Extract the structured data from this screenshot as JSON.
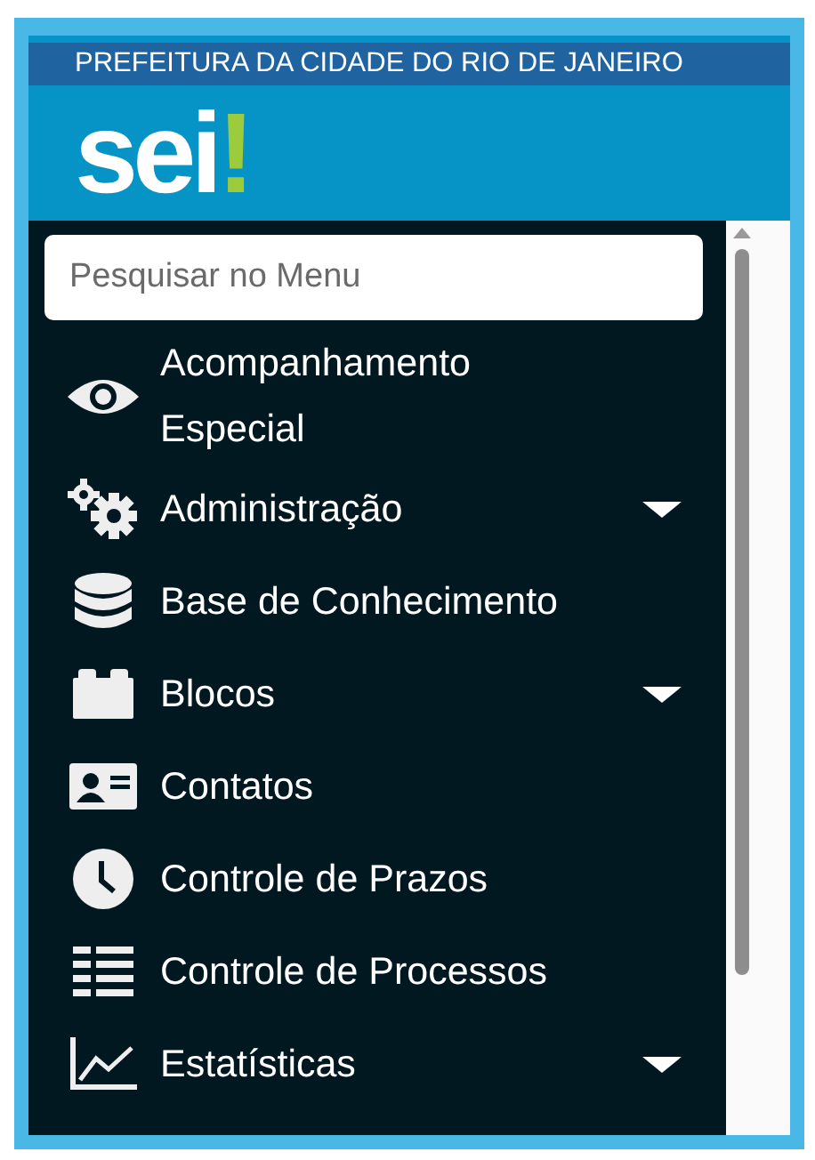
{
  "banner": {
    "title": "PREFEITURA DA CIDADE DO RIO DE JANEIRO"
  },
  "logo": {
    "text": "sei",
    "mark": "!"
  },
  "search": {
    "placeholder": "Pesquisar no Menu"
  },
  "menu": [
    {
      "label": "Acompanhamento Especial",
      "kind": "eye",
      "submenu": false
    },
    {
      "label": "Administração",
      "kind": "gears",
      "submenu": true
    },
    {
      "label": "Base de Conhecimento",
      "kind": "database",
      "submenu": false
    },
    {
      "label": "Blocos",
      "kind": "blocks",
      "submenu": true
    },
    {
      "label": "Contatos",
      "kind": "contact",
      "submenu": false
    },
    {
      "label": "Controle de Prazos",
      "kind": "clock",
      "submenu": false
    },
    {
      "label": "Controle de Processos",
      "kind": "list",
      "submenu": false
    },
    {
      "label": "Estatísticas",
      "kind": "chart",
      "submenu": true
    }
  ]
}
